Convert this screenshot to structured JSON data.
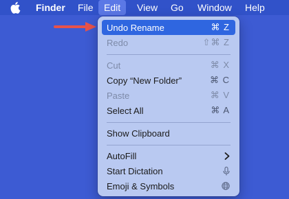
{
  "menubar": {
    "items": [
      "Finder",
      "File",
      "Edit",
      "View",
      "Go",
      "Window",
      "Help"
    ]
  },
  "edit_menu": {
    "items": [
      {
        "label": "Undo Rename",
        "shortcut": "⌘ Z",
        "state": "selected"
      },
      {
        "label": "Redo",
        "shortcut": "⇧⌘ Z",
        "state": "disabled"
      },
      {
        "label": "Cut",
        "shortcut": "⌘ X",
        "state": "disabled"
      },
      {
        "label": "Copy “New Folder”",
        "shortcut": "⌘ C",
        "state": "enabled"
      },
      {
        "label": "Paste",
        "shortcut": "⌘ V",
        "state": "disabled"
      },
      {
        "label": "Select All",
        "shortcut": "⌘ A",
        "state": "enabled"
      },
      {
        "label": "Show Clipboard",
        "shortcut": "",
        "state": "enabled"
      },
      {
        "label": "AutoFill",
        "icon": "chevron-right-icon",
        "state": "enabled"
      },
      {
        "label": "Start Dictation",
        "icon": "microphone-icon",
        "state": "enabled"
      },
      {
        "label": "Emoji & Symbols",
        "icon": "globe-icon",
        "state": "enabled"
      }
    ]
  },
  "annotation": {
    "icon": "red-pointer-arrow-icon",
    "color": "#e8524a"
  },
  "colors": {
    "desktop": "#3d5bd3",
    "menubar": "#3152c9",
    "menu_bg": "#b9c9f1",
    "highlight": "#2f66e0"
  }
}
